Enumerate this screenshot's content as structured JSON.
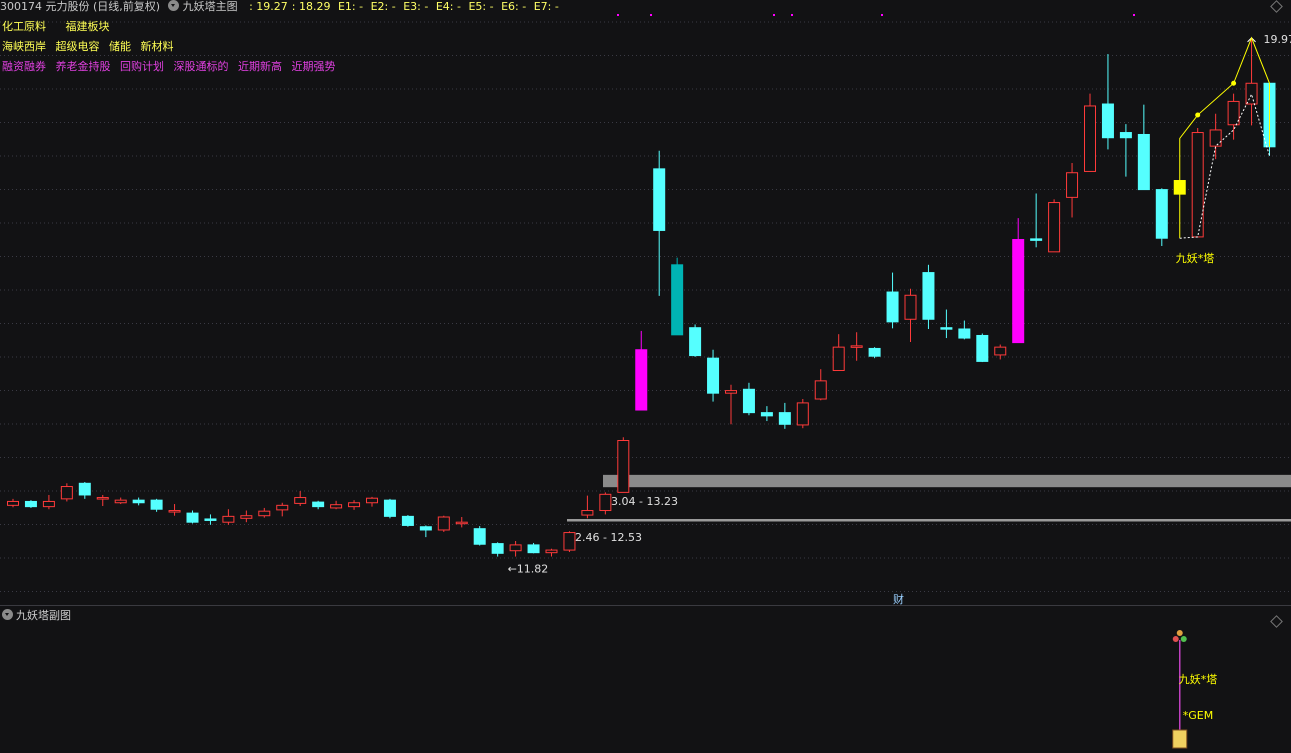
{
  "header": {
    "stock": "300174 元力股份 (日线,前复权)",
    "indicator": "九妖塔主图",
    "values": [
      "19.27",
      "18.29",
      "E1: -",
      "E2: -",
      "E3: -",
      "E4: -",
      "E5: -",
      "E6: -",
      "E7: -"
    ]
  },
  "tags_row1": [
    "化工原料",
    "福建板块"
  ],
  "tags_row2": [
    "海峡西岸",
    "超级电容",
    "储能",
    "新材料"
  ],
  "tags_row3": [
    "融资融券",
    "养老金持股",
    "回购计划",
    "深股通标的",
    "近期新高",
    "近期强势"
  ],
  "subchart": {
    "title": "九妖塔副图",
    "label1": "九妖*塔",
    "label2": "*GEM"
  },
  "colors": {
    "up": "#ff3a3a",
    "down": "#55ffff",
    "magenta": "#ff00ff",
    "teal": "#00b4b4",
    "yellow": "#ffff00",
    "zone": "#8a8a8a",
    "bg": "#121214"
  },
  "chart_data": {
    "type": "candlestick",
    "title": "",
    "ylim": [
      11.3,
      20.4
    ],
    "candles": [
      {
        "o": 12.76,
        "c": 12.82,
        "h": 12.86,
        "l": 12.73
      },
      {
        "o": 12.82,
        "c": 12.74,
        "h": 12.84,
        "l": 12.72
      },
      {
        "o": 12.74,
        "c": 12.82,
        "h": 12.92,
        "l": 12.7
      },
      {
        "o": 12.86,
        "c": 13.05,
        "h": 13.1,
        "l": 12.82
      },
      {
        "o": 13.1,
        "c": 12.92,
        "h": 13.12,
        "l": 12.86
      },
      {
        "o": 12.86,
        "c": 12.88,
        "h": 12.92,
        "l": 12.75
      },
      {
        "o": 12.8,
        "c": 12.84,
        "h": 12.88,
        "l": 12.78
      },
      {
        "o": 12.84,
        "c": 12.8,
        "h": 12.88,
        "l": 12.76
      },
      {
        "o": 12.84,
        "c": 12.7,
        "h": 12.86,
        "l": 12.66
      },
      {
        "o": 12.66,
        "c": 12.68,
        "h": 12.78,
        "l": 12.6
      },
      {
        "o": 12.64,
        "c": 12.5,
        "h": 12.68,
        "l": 12.48
      },
      {
        "o": 12.55,
        "c": 12.54,
        "h": 12.62,
        "l": 12.46
      },
      {
        "o": 12.5,
        "c": 12.59,
        "h": 12.7,
        "l": 12.46
      },
      {
        "o": 12.56,
        "c": 12.6,
        "h": 12.68,
        "l": 12.5
      },
      {
        "o": 12.6,
        "c": 12.67,
        "h": 12.72,
        "l": 12.57
      },
      {
        "o": 12.69,
        "c": 12.76,
        "h": 12.8,
        "l": 12.59
      },
      {
        "o": 12.79,
        "c": 12.88,
        "h": 12.98,
        "l": 12.75
      },
      {
        "o": 12.81,
        "c": 12.74,
        "h": 12.83,
        "l": 12.7
      },
      {
        "o": 12.72,
        "c": 12.77,
        "h": 12.83,
        "l": 12.7
      },
      {
        "o": 12.74,
        "c": 12.8,
        "h": 12.84,
        "l": 12.69
      },
      {
        "o": 12.8,
        "c": 12.87,
        "h": 12.89,
        "l": 12.74
      },
      {
        "o": 12.84,
        "c": 12.59,
        "h": 12.86,
        "l": 12.56
      },
      {
        "o": 12.59,
        "c": 12.45,
        "h": 12.61,
        "l": 12.43
      },
      {
        "o": 12.43,
        "c": 12.38,
        "h": 12.45,
        "l": 12.27
      },
      {
        "o": 12.38,
        "c": 12.58,
        "h": 12.6,
        "l": 12.35
      },
      {
        "o": 12.48,
        "c": 12.5,
        "h": 12.58,
        "l": 12.42
      },
      {
        "o": 12.4,
        "c": 12.16,
        "h": 12.44,
        "l": 12.14
      },
      {
        "o": 12.17,
        "c": 12.02,
        "h": 12.19,
        "l": 11.97
      },
      {
        "o": 12.06,
        "c": 12.15,
        "h": 12.21,
        "l": 11.97
      },
      {
        "o": 12.15,
        "c": 12.03,
        "h": 12.18,
        "l": 12.02
      },
      {
        "o": 12.03,
        "c": 12.07,
        "h": 12.09,
        "l": 11.97
      },
      {
        "o": 12.07,
        "c": 12.34,
        "h": 12.36,
        "l": 12.04
      },
      {
        "o": 12.61,
        "c": 12.68,
        "h": 12.91,
        "l": 12.56
      },
      {
        "o": 12.68,
        "c": 12.93,
        "h": 12.96,
        "l": 12.62
      },
      {
        "o": 12.96,
        "c": 13.76,
        "h": 13.81,
        "l": 12.96
      },
      {
        "o": 14.23,
        "c": 15.16,
        "h": 15.45,
        "l": 14.23,
        "clr": "magenta"
      },
      {
        "o": 17.95,
        "c": 17.0,
        "h": 18.23,
        "l": 15.99
      },
      {
        "o": 16.47,
        "c": 15.39,
        "h": 16.58,
        "l": 15.39,
        "clr": "teal"
      },
      {
        "o": 15.5,
        "c": 15.07,
        "h": 15.55,
        "l": 15.05
      },
      {
        "o": 15.03,
        "c": 14.49,
        "h": 15.16,
        "l": 14.36
      },
      {
        "o": 14.49,
        "c": 14.53,
        "h": 14.62,
        "l": 14.01
      },
      {
        "o": 14.55,
        "c": 14.19,
        "h": 14.65,
        "l": 14.15
      },
      {
        "o": 14.19,
        "c": 14.14,
        "h": 14.29,
        "l": 14.06
      },
      {
        "o": 14.19,
        "c": 14.01,
        "h": 14.34,
        "l": 13.94
      },
      {
        "o": 14.0,
        "c": 14.34,
        "h": 14.4,
        "l": 13.95
      },
      {
        "o": 14.4,
        "c": 14.68,
        "h": 14.86,
        "l": 14.38
      },
      {
        "o": 14.84,
        "c": 15.2,
        "h": 15.4,
        "l": 14.84
      },
      {
        "o": 15.22,
        "c": 15.22,
        "h": 15.43,
        "l": 14.99
      },
      {
        "o": 15.18,
        "c": 15.06,
        "h": 15.2,
        "l": 15.03
      },
      {
        "o": 16.05,
        "c": 15.59,
        "h": 16.35,
        "l": 15.49
      },
      {
        "o": 15.63,
        "c": 16.0,
        "h": 16.1,
        "l": 15.28
      },
      {
        "o": 16.35,
        "c": 15.63,
        "h": 16.47,
        "l": 15.48
      },
      {
        "o": 15.5,
        "c": 15.48,
        "h": 15.78,
        "l": 15.34
      },
      {
        "o": 15.48,
        "c": 15.34,
        "h": 15.61,
        "l": 15.32
      },
      {
        "o": 15.38,
        "c": 14.98,
        "h": 15.41,
        "l": 14.97
      },
      {
        "o": 15.08,
        "c": 15.2,
        "h": 15.24,
        "l": 15.01
      },
      {
        "o": 15.27,
        "c": 16.86,
        "h": 17.19,
        "l": 15.27,
        "clr": "magenta"
      },
      {
        "o": 16.87,
        "c": 16.86,
        "h": 17.57,
        "l": 16.74
      },
      {
        "o": 16.67,
        "c": 17.43,
        "h": 17.48,
        "l": 16.67
      },
      {
        "o": 17.51,
        "c": 17.89,
        "h": 18.04,
        "l": 17.2
      },
      {
        "o": 17.91,
        "c": 18.92,
        "h": 19.11,
        "l": 17.91
      },
      {
        "o": 18.95,
        "c": 18.43,
        "h": 19.72,
        "l": 18.25
      },
      {
        "o": 18.51,
        "c": 18.43,
        "h": 18.64,
        "l": 17.83
      },
      {
        "o": 18.48,
        "c": 17.63,
        "h": 18.94,
        "l": 17.63
      },
      {
        "o": 17.63,
        "c": 16.88,
        "h": 17.65,
        "l": 16.76
      },
      {
        "o": 17.56,
        "c": 17.77,
        "h": 17.77,
        "l": 17.56,
        "clr": "yellow"
      },
      {
        "o": 16.9,
        "c": 18.51,
        "h": 18.58,
        "l": 16.9
      },
      {
        "o": 18.3,
        "c": 18.55,
        "h": 18.8,
        "l": 18.1
      },
      {
        "o": 18.63,
        "c": 18.99,
        "h": 19.11,
        "l": 18.4
      },
      {
        "o": 18.95,
        "c": 19.27,
        "h": 19.97,
        "l": 18.62
      },
      {
        "o": 19.27,
        "c": 18.29,
        "h": 19.27,
        "l": 18.15
      }
    ],
    "annotations": [
      {
        "text": "←11.82",
        "value": 11.82
      },
      {
        "text": "19.97",
        "value": 19.97
      },
      {
        "text": "九妖*塔"
      }
    ],
    "zones": [
      {
        "label": "13.04 - 13.23",
        "low": 13.04,
        "high": 13.23
      },
      {
        "label": "12.46 - 12.53",
        "low": 12.46,
        "high": 12.53
      }
    ],
    "marker": "财"
  }
}
